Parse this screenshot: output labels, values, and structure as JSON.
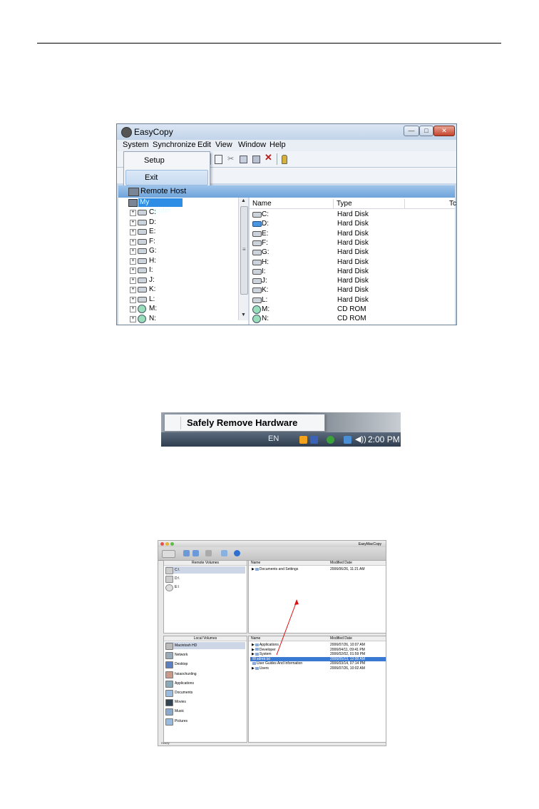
{
  "windows_app": {
    "title": "EasyCopy",
    "controls": {
      "minimize": "—",
      "maximize": "□",
      "close": "✕"
    },
    "menu": [
      "System",
      "Synchronize",
      "Edit",
      "View",
      "Window",
      "Help"
    ],
    "dropdown": [
      "Setup",
      "Exit"
    ],
    "toolbar_icons": [
      "new-icon",
      "cut-icon",
      "copy-icon",
      "paste-icon",
      "delete-icon",
      "key-icon"
    ],
    "toolbar_glyphs": {
      "delete": "✕"
    },
    "remote_host_label": "Remote Host",
    "tree_root": "My Computer",
    "tree_items": [
      {
        "label": "C:",
        "kind": "disk"
      },
      {
        "label": "D:",
        "kind": "disk"
      },
      {
        "label": "E:",
        "kind": "disk"
      },
      {
        "label": "F:",
        "kind": "disk"
      },
      {
        "label": "G:",
        "kind": "disk"
      },
      {
        "label": "H:",
        "kind": "disk"
      },
      {
        "label": "I:",
        "kind": "disk"
      },
      {
        "label": "J:",
        "kind": "disk"
      },
      {
        "label": "K:",
        "kind": "disk"
      },
      {
        "label": "L:",
        "kind": "disk"
      },
      {
        "label": "M:",
        "kind": "cd"
      },
      {
        "label": "N:",
        "kind": "cd"
      }
    ],
    "columns": [
      "Name",
      "Type",
      "Tc"
    ],
    "rows": [
      {
        "name": "C:",
        "type": "Hard Disk",
        "kind": "disk"
      },
      {
        "name": "D:",
        "type": "Hard Disk",
        "kind": "disk-blue"
      },
      {
        "name": "E:",
        "type": "Hard Disk",
        "kind": "disk"
      },
      {
        "name": "F:",
        "type": "Hard Disk",
        "kind": "disk"
      },
      {
        "name": "G:",
        "type": "Hard Disk",
        "kind": "disk"
      },
      {
        "name": "H:",
        "type": "Hard Disk",
        "kind": "disk"
      },
      {
        "name": "I:",
        "type": "Hard Disk",
        "kind": "disk"
      },
      {
        "name": "J:",
        "type": "Hard Disk",
        "kind": "disk"
      },
      {
        "name": "K:",
        "type": "Hard Disk",
        "kind": "disk"
      },
      {
        "name": "L:",
        "type": "Hard Disk",
        "kind": "disk"
      },
      {
        "name": "M:",
        "type": "CD ROM",
        "kind": "cd"
      },
      {
        "name": "N:",
        "type": "CD ROM",
        "kind": "cd"
      }
    ]
  },
  "taskbar": {
    "menu_item": "Safely Remove Hardware",
    "language": "EN",
    "clock": "2:00 PM",
    "speaker_glyph": "◀))",
    "tray_colors": [
      "#f2a21b",
      "#3a63b8",
      "#3aa03a",
      "#4a8fd6"
    ]
  },
  "mac_app": {
    "title": "EasyMacCopy",
    "traffic_lights": [
      "#e5524a",
      "#e5b13a",
      "#5cbf43"
    ],
    "remote_volumes_header": "Remote Volumes",
    "remote_volumes": [
      "C:\\",
      "D:\\",
      "E:\\"
    ],
    "remote_columns": [
      "Name",
      "Modified Date"
    ],
    "remote_rows": [
      {
        "name": "Documents and Settings",
        "date": "2006/06/26, 11:21 AM"
      }
    ],
    "local_volumes_header": "Local Volumes",
    "local_volumes": [
      "Macintosh HD",
      "Network",
      "Desktop",
      "hsiaochunling",
      "Applications",
      "Documents",
      "Movies",
      "Music",
      "Pictures"
    ],
    "local_columns": [
      "Name",
      "Modified Date"
    ],
    "local_rows": [
      {
        "name": "Applications",
        "date": "2006/07/26, 10:07 AM",
        "selected": false
      },
      {
        "name": "Developer",
        "date": "2006/04/11, 09:41 PM",
        "selected": false
      },
      {
        "name": "System",
        "date": "2006/02/02, 01:59 PM",
        "selected": false
      },
      {
        "name": "sdmtr.txt",
        "date": "2006/05/13, 12:00 AM",
        "selected": true
      },
      {
        "name": "User Guides And Information",
        "date": "2006/03/14, 07:14 PM",
        "selected": false
      },
      {
        "name": "Users",
        "date": "2006/07/26, 10:02 AM",
        "selected": false
      }
    ],
    "status": "Ready",
    "accent_red": "#d11"
  }
}
